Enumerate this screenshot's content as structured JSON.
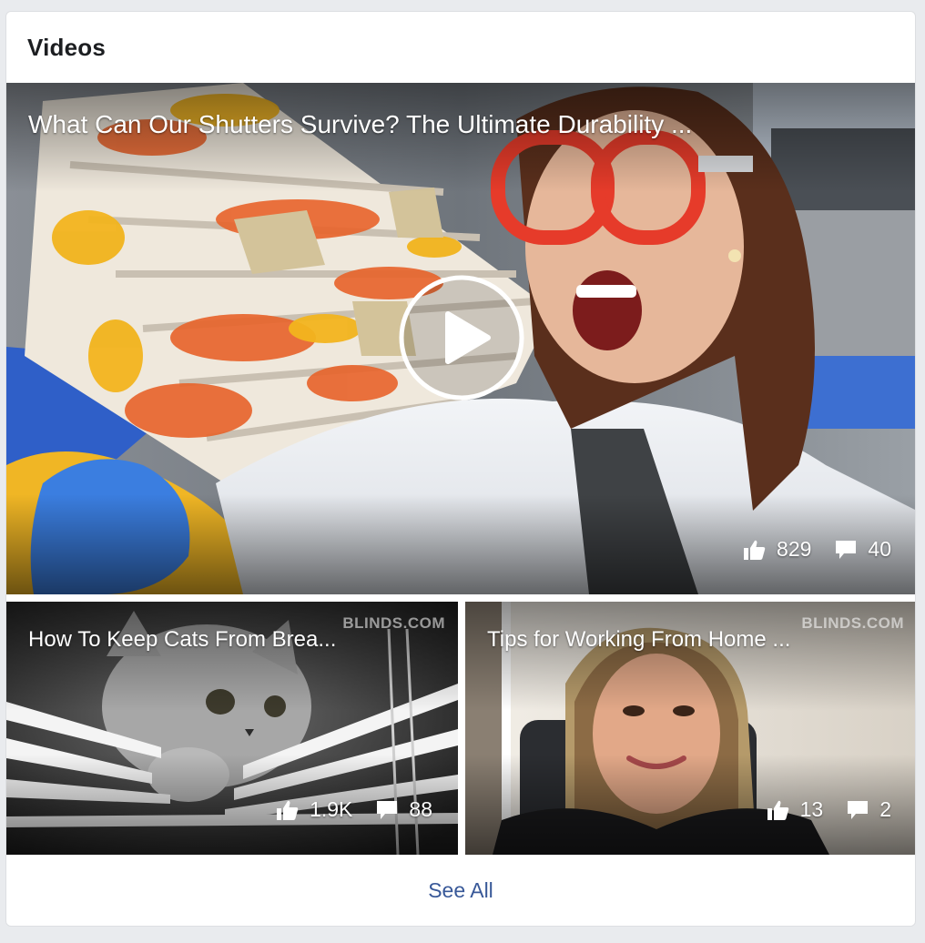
{
  "card": {
    "title": "Videos"
  },
  "featured": {
    "title": "What Can Our Shutters Survive? The Ultimate Durability ...",
    "likes": "829",
    "comments": "40"
  },
  "videos": [
    {
      "title": "How To Keep Cats From Brea...",
      "watermark": "BLINDS.COM",
      "likes": "1.9K",
      "comments": "88"
    },
    {
      "title": "Tips for Working From Home ...",
      "watermark": "BLINDS.COM",
      "likes": "13",
      "comments": "2"
    }
  ],
  "footer": {
    "see_all": "See All"
  },
  "icons": {
    "like": "thumbs-up-icon",
    "comment": "comment-bubble-icon",
    "play": "play-icon"
  },
  "colors": {
    "link": "#385898",
    "background": "#e9ebee",
    "card": "#ffffff"
  }
}
